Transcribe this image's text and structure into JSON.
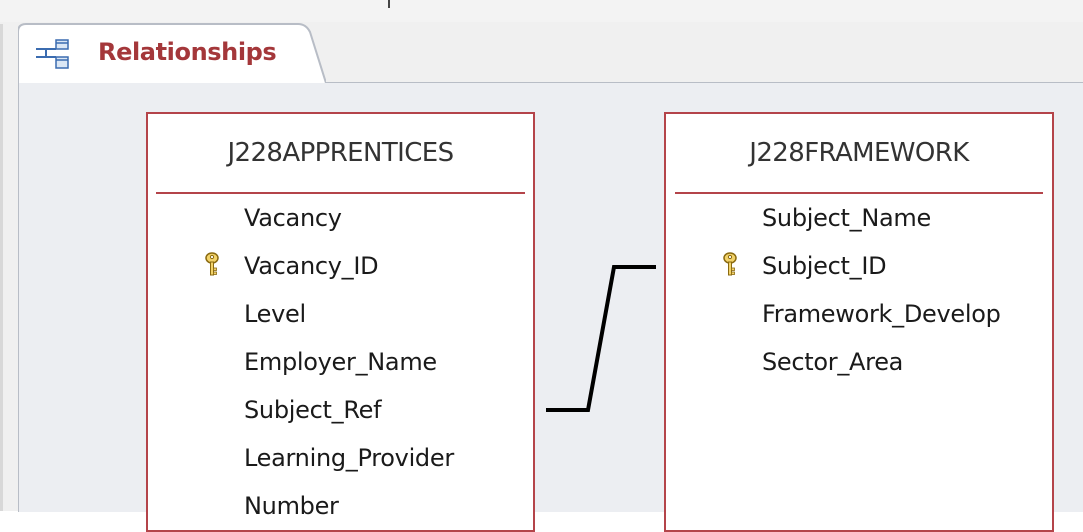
{
  "tab": {
    "label": "Relationships",
    "icon": "relationships-icon"
  },
  "colors": {
    "accent": "#a4373a",
    "table_border": "#b4444a",
    "canvas_background": "#eceef2",
    "relationship_line": "#000000"
  },
  "tables": [
    {
      "name": "J228APPRENTICES",
      "fields": [
        {
          "label": "Vacancy",
          "primary_key": false
        },
        {
          "label": "Vacancy_ID",
          "primary_key": true
        },
        {
          "label": "Level",
          "primary_key": false
        },
        {
          "label": "Employer_Name",
          "primary_key": false
        },
        {
          "label": "Subject_Ref",
          "primary_key": false
        },
        {
          "label": "Learning_Provider",
          "primary_key": false
        },
        {
          "label": "Number",
          "primary_key": false
        }
      ]
    },
    {
      "name": "J228FRAMEWORK",
      "fields": [
        {
          "label": "Subject_Name",
          "primary_key": false
        },
        {
          "label": "Subject_ID",
          "primary_key": true
        },
        {
          "label": "Framework_Develop",
          "primary_key": false
        },
        {
          "label": "Sector_Area",
          "primary_key": false
        }
      ]
    }
  ],
  "relationship": {
    "from": "J228APPRENTICES.Subject_Ref",
    "to": "J228FRAMEWORK.Subject_ID"
  }
}
